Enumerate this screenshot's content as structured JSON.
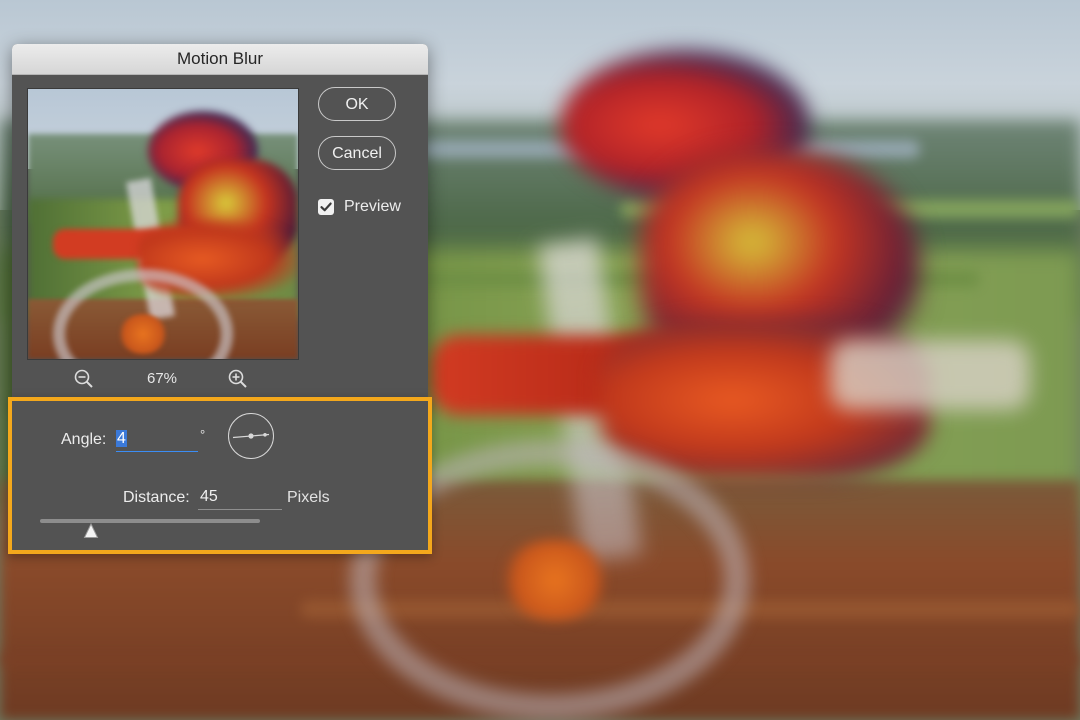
{
  "dialog": {
    "title": "Motion Blur",
    "ok_label": "OK",
    "cancel_label": "Cancel",
    "preview_label": "Preview",
    "preview_checked": true,
    "zoom_level": "67%"
  },
  "options": {
    "angle_label": "Angle:",
    "angle_value": "4",
    "angle_unit": "°",
    "distance_label": "Distance:",
    "distance_value": "45",
    "distance_unit": "Pixels",
    "distance_slider_fraction": 0.23
  },
  "colors": {
    "dialog_bg": "#535353",
    "highlight_border": "#f4a81c",
    "selection": "#3b79d8"
  },
  "icons": {
    "zoom_out": "zoom-out-magnifier",
    "zoom_in": "zoom-in-magnifier",
    "angle_dial": "angle-dial",
    "checkbox": "checkmark",
    "slider": "triangle-thumb"
  }
}
